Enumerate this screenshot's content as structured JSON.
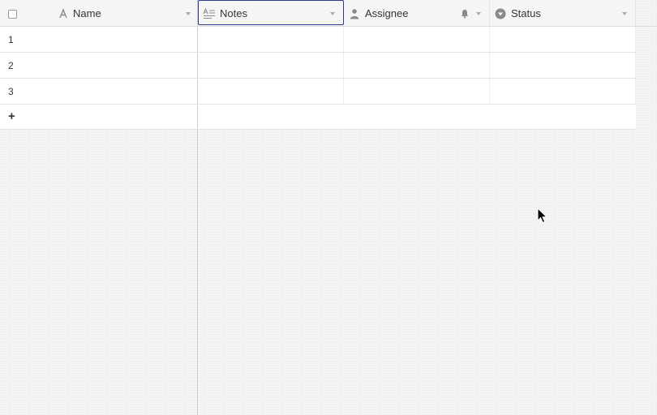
{
  "grid": {
    "columns": [
      {
        "key": "name",
        "label": "Name",
        "icon": "text-icon",
        "primary": true
      },
      {
        "key": "notes",
        "label": "Notes",
        "icon": "long-text-icon",
        "selected": true
      },
      {
        "key": "assignee",
        "label": "Assignee",
        "icon": "person-icon",
        "extra_icon": "bell-icon"
      },
      {
        "key": "status",
        "label": "Status",
        "icon": "single-select-icon"
      }
    ],
    "rows": [
      {
        "number": "1",
        "name": "",
        "notes": "",
        "assignee": "",
        "status": ""
      },
      {
        "number": "2",
        "name": "",
        "notes": "",
        "assignee": "",
        "status": ""
      },
      {
        "number": "3",
        "name": "",
        "notes": "",
        "assignee": "",
        "status": ""
      }
    ],
    "add_row_label": "+"
  },
  "colors": {
    "selected_border": "#2d3a8c",
    "header_bg": "#f5f5f5",
    "icon": "#8a8a8a"
  }
}
